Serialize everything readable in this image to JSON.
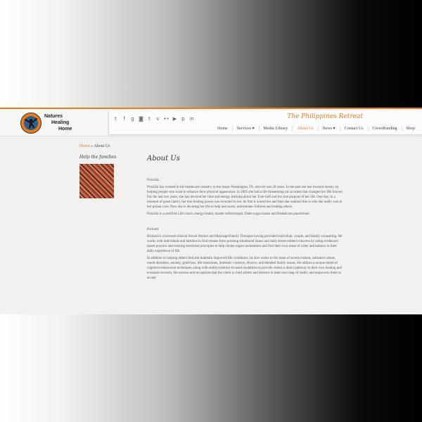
{
  "brand": {
    "name_lines": [
      "Natures",
      "Healing",
      "Home"
    ],
    "tagline": "The Philippines Retreat"
  },
  "colors": {
    "accent": "#e87b1e"
  },
  "social_icons": [
    "twitter-icon",
    "facebook-icon",
    "google-plus-icon",
    "instagram-icon",
    "tumblr-icon",
    "vimeo-icon",
    "flickr-icon",
    "youtube-icon",
    "pinterest-icon",
    "linkedin-icon"
  ],
  "nav": {
    "items": [
      "Home",
      "Services ▾",
      "Media Library",
      "About Us",
      "News ▾",
      "Contact Us",
      "Crowdfunding",
      "Shop"
    ],
    "active": "About Us"
  },
  "breadcrumb": {
    "home": "Home",
    "sep": "»",
    "current": "About Us"
  },
  "sidebar": {
    "title": "Help the families"
  },
  "page": {
    "title": "About Us",
    "p1_heading": "Priscilla:",
    "p1": "Priscilla has worked in the healthcare industry in the major Washington, DC area for last 20 years. In the past she has focused mostly on helping people who want to enhance their physical appearance. In 2005 she had a life threatening car accident that changed her life forever. For the last two years, she has devoted her time and energy learning about her True-Self and the true purpose of her life. One day, in a moment of great clarity, her true healing power was revealed to her. At first it scared her and then she realized this is who she really was at her primal core. Now she is devoting her life to help and assist, unfortunate children and healing others.",
    "p2": "Priscilla is a certified Life coach, energy healer, master reflexologist, Dahn yoga master and Healthcare practitioner.",
    "p3_heading": "Richard:",
    "p3": "Richard is a licensed clinical Social Worker and Marriage/Family Therapist having provided individual, couple, and family counseling. He works with individuals and families to find release from pressing situational issues and daily stress-related concerns by using evidenced based practice and existing structural principles to help clients regain momentum and find their own sense of order and balance in their daily experience of life.",
    "p4": "In addition to helping others find and maintain improved life conditions, he also works in the areas of severe trauma, substance abuse, mood disorders, anxiety, grief/loss, life transitions, domestic violence, divorce, and blended family issues. He utilizes a unique blend of cognitive-behavioral techniques along with reality/solution focused modalities to provide clients a direct pathway to their own healing and eventual recovery. He teaches and recognizes that the client is chief arbiter and director in their own map of reality and empowers them to accept"
  }
}
